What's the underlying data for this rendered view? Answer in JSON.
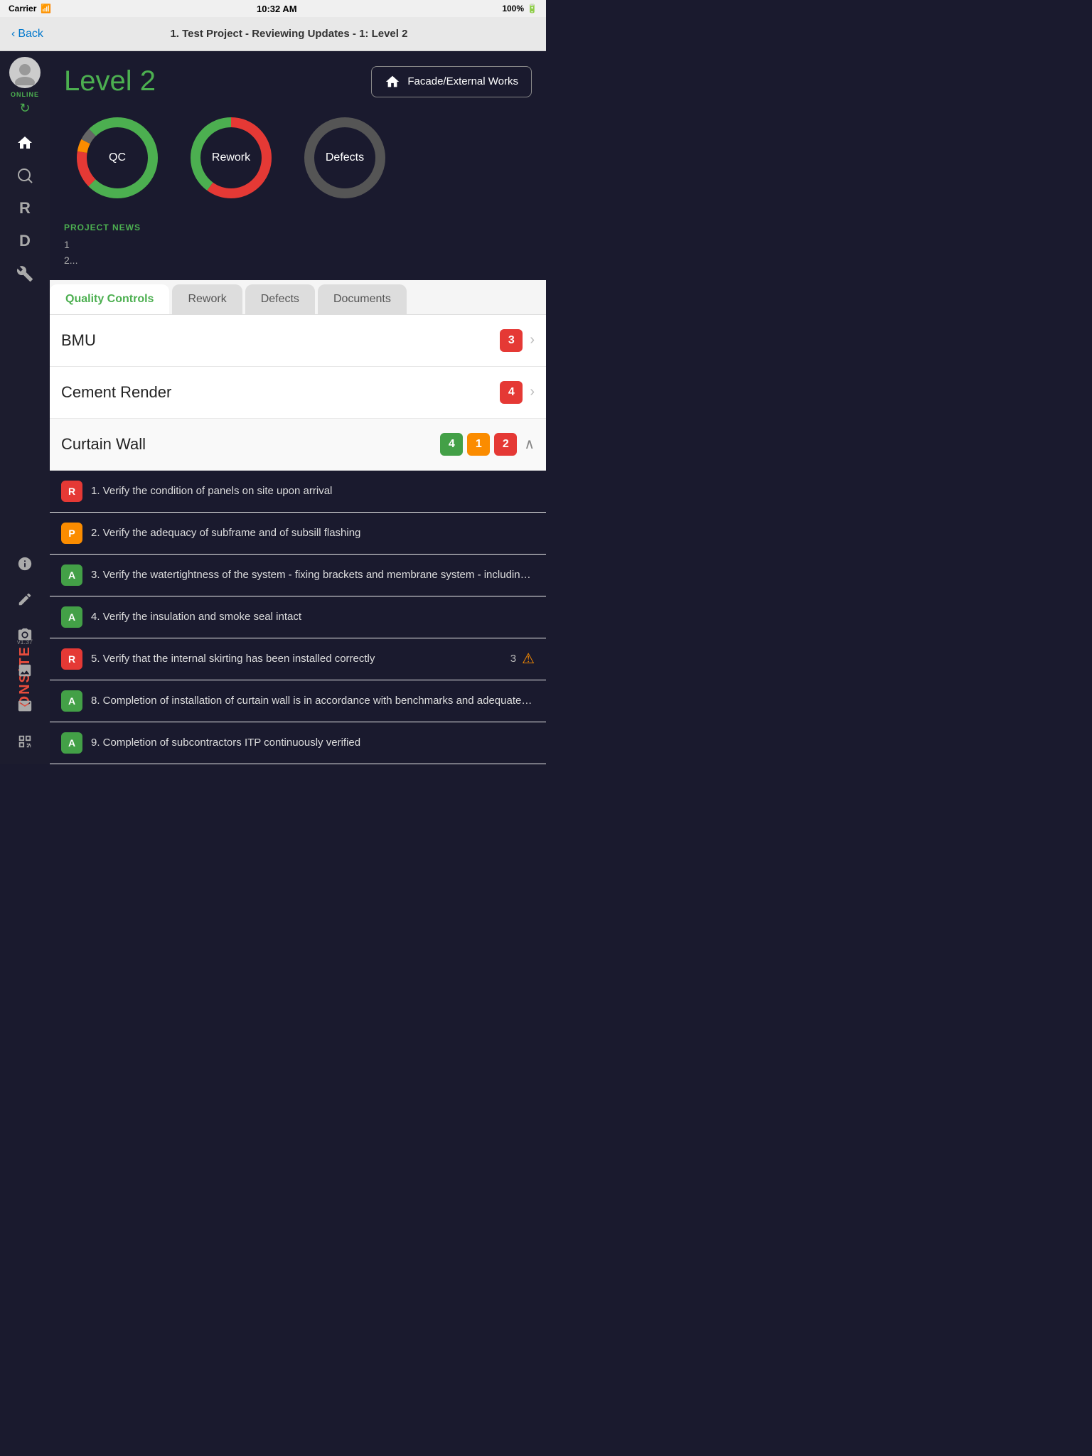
{
  "statusBar": {
    "carrier": "Carrier",
    "time": "10:32 AM",
    "battery": "100%"
  },
  "navBar": {
    "backLabel": "Back",
    "title": "1. Test Project - Reviewing Updates - 1: Level 2"
  },
  "sidebar": {
    "status": "ONLINE",
    "version": "v1.37",
    "brand": "ONSiTE",
    "icons": [
      "home",
      "qc",
      "rework",
      "defects",
      "tools"
    ]
  },
  "header": {
    "levelLabel": "Level",
    "levelNumber": "2",
    "locationButton": "Facade/External Works"
  },
  "charts": [
    {
      "label": "QC",
      "type": "qc"
    },
    {
      "label": "Rework",
      "type": "rework"
    },
    {
      "label": "Defects",
      "type": "defects"
    }
  ],
  "news": {
    "title": "PROJECT NEWS",
    "items": [
      "1",
      "2..."
    ]
  },
  "tabs": [
    {
      "label": "Quality Controls",
      "active": true
    },
    {
      "label": "Rework",
      "active": false
    },
    {
      "label": "Defects",
      "active": false
    },
    {
      "label": "Documents",
      "active": false
    }
  ],
  "listItems": [
    {
      "label": "BMU",
      "badges": [
        {
          "count": "3",
          "color": "red"
        }
      ],
      "expanded": false
    },
    {
      "label": "Cement Render",
      "badges": [
        {
          "count": "4",
          "color": "red"
        }
      ],
      "expanded": false
    },
    {
      "label": "Curtain Wall",
      "badges": [
        {
          "count": "4",
          "color": "green"
        },
        {
          "count": "1",
          "color": "orange"
        },
        {
          "count": "2",
          "color": "red"
        }
      ],
      "expanded": true
    }
  ],
  "subItems": [
    {
      "badge": "R",
      "badgeColor": "red",
      "text": "1. Verify the condition of panels on site upon arrival",
      "count": null,
      "warning": false
    },
    {
      "badge": "P",
      "badgeColor": "orange",
      "text": "2. Verify the adequacy of subframe and of subsill flashing",
      "count": null,
      "warning": false
    },
    {
      "badge": "A",
      "badgeColor": "green",
      "text": "3. Verify the watertightness of the system - fixing brackets and membrane system - includin…",
      "count": null,
      "warning": false
    },
    {
      "badge": "A",
      "badgeColor": "green",
      "text": "4. Verify the insulation and smoke seal intact",
      "count": null,
      "warning": false
    },
    {
      "badge": "R",
      "badgeColor": "red",
      "text": "5. Verify that the internal skirting has been installed correctly",
      "count": "3",
      "warning": true
    },
    {
      "badge": "A",
      "badgeColor": "green",
      "text": "8. Completion of installation of curtain wall is in accordance with benchmarks and adequate…",
      "count": null,
      "warning": false
    },
    {
      "badge": "A",
      "badgeColor": "green",
      "text": "9. Completion of subcontractors ITP continuously verified",
      "count": null,
      "warning": false
    }
  ]
}
